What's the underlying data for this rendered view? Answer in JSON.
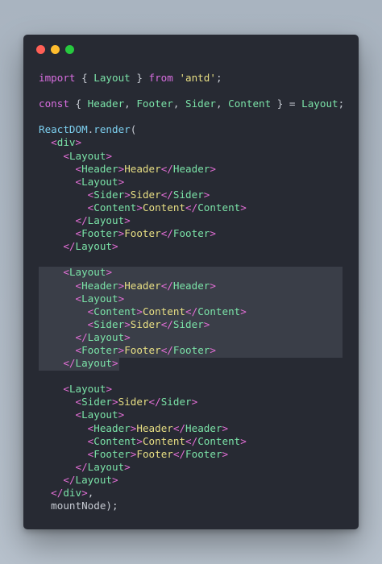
{
  "window": {
    "controls": [
      "close",
      "minimize",
      "maximize"
    ],
    "colors": {
      "close": "#ff5f56",
      "minimize": "#ffbd2e",
      "maximize": "#27c93f",
      "background": "#272a33"
    }
  },
  "code": {
    "language": "jsx",
    "highlighted_lines": [
      15,
      16,
      17,
      18,
      19,
      20,
      21
    ],
    "lines": [
      [
        {
          "t": "kw",
          "v": "import"
        },
        {
          "t": "pn",
          "v": " { "
        },
        {
          "t": "id",
          "v": "Layout"
        },
        {
          "t": "pn",
          "v": " } "
        },
        {
          "t": "kw",
          "v": "from"
        },
        {
          "t": "pn",
          "v": " "
        },
        {
          "t": "str",
          "v": "'antd'"
        },
        {
          "t": "pn",
          "v": ";"
        }
      ],
      [],
      [
        {
          "t": "kw",
          "v": "const"
        },
        {
          "t": "pn",
          "v": " { "
        },
        {
          "t": "id",
          "v": "Header"
        },
        {
          "t": "pn",
          "v": ", "
        },
        {
          "t": "id",
          "v": "Footer"
        },
        {
          "t": "pn",
          "v": ", "
        },
        {
          "t": "id",
          "v": "Sider"
        },
        {
          "t": "pn",
          "v": ", "
        },
        {
          "t": "id",
          "v": "Content"
        },
        {
          "t": "pn",
          "v": " } = "
        },
        {
          "t": "id",
          "v": "Layout"
        },
        {
          "t": "pn",
          "v": ";"
        }
      ],
      [],
      [
        {
          "t": "fn",
          "v": "ReactDOM"
        },
        {
          "t": "pn",
          "v": "."
        },
        {
          "t": "fn",
          "v": "render"
        },
        {
          "t": "pn",
          "v": "("
        }
      ],
      [
        {
          "t": "pn",
          "v": "  "
        },
        {
          "t": "tg",
          "v": "<"
        },
        {
          "t": "tn",
          "v": "div"
        },
        {
          "t": "tg",
          "v": ">"
        }
      ],
      [
        {
          "t": "pn",
          "v": "    "
        },
        {
          "t": "tg",
          "v": "<"
        },
        {
          "t": "tn",
          "v": "Layout"
        },
        {
          "t": "tg",
          "v": ">"
        }
      ],
      [
        {
          "t": "pn",
          "v": "      "
        },
        {
          "t": "tg",
          "v": "<"
        },
        {
          "t": "tn",
          "v": "Header"
        },
        {
          "t": "tg",
          "v": ">"
        },
        {
          "t": "tx",
          "v": "Header"
        },
        {
          "t": "tg",
          "v": "</"
        },
        {
          "t": "tn",
          "v": "Header"
        },
        {
          "t": "tg",
          "v": ">"
        }
      ],
      [
        {
          "t": "pn",
          "v": "      "
        },
        {
          "t": "tg",
          "v": "<"
        },
        {
          "t": "tn",
          "v": "Layout"
        },
        {
          "t": "tg",
          "v": ">"
        }
      ],
      [
        {
          "t": "pn",
          "v": "        "
        },
        {
          "t": "tg",
          "v": "<"
        },
        {
          "t": "tn",
          "v": "Sider"
        },
        {
          "t": "tg",
          "v": ">"
        },
        {
          "t": "tx",
          "v": "Sider"
        },
        {
          "t": "tg",
          "v": "</"
        },
        {
          "t": "tn",
          "v": "Sider"
        },
        {
          "t": "tg",
          "v": ">"
        }
      ],
      [
        {
          "t": "pn",
          "v": "        "
        },
        {
          "t": "tg",
          "v": "<"
        },
        {
          "t": "tn",
          "v": "Content"
        },
        {
          "t": "tg",
          "v": ">"
        },
        {
          "t": "tx",
          "v": "Content"
        },
        {
          "t": "tg",
          "v": "</"
        },
        {
          "t": "tn",
          "v": "Content"
        },
        {
          "t": "tg",
          "v": ">"
        }
      ],
      [
        {
          "t": "pn",
          "v": "      "
        },
        {
          "t": "tg",
          "v": "</"
        },
        {
          "t": "tn",
          "v": "Layout"
        },
        {
          "t": "tg",
          "v": ">"
        }
      ],
      [
        {
          "t": "pn",
          "v": "      "
        },
        {
          "t": "tg",
          "v": "<"
        },
        {
          "t": "tn",
          "v": "Footer"
        },
        {
          "t": "tg",
          "v": ">"
        },
        {
          "t": "tx",
          "v": "Footer"
        },
        {
          "t": "tg",
          "v": "</"
        },
        {
          "t": "tn",
          "v": "Footer"
        },
        {
          "t": "tg",
          "v": ">"
        }
      ],
      [
        {
          "t": "pn",
          "v": "    "
        },
        {
          "t": "tg",
          "v": "</"
        },
        {
          "t": "tn",
          "v": "Layout"
        },
        {
          "t": "tg",
          "v": ">"
        }
      ],
      [],
      [
        {
          "t": "pn",
          "v": "    "
        },
        {
          "t": "tg",
          "v": "<"
        },
        {
          "t": "tn",
          "v": "Layout"
        },
        {
          "t": "tg",
          "v": ">"
        }
      ],
      [
        {
          "t": "pn",
          "v": "      "
        },
        {
          "t": "tg",
          "v": "<"
        },
        {
          "t": "tn",
          "v": "Header"
        },
        {
          "t": "tg",
          "v": ">"
        },
        {
          "t": "tx",
          "v": "Header"
        },
        {
          "t": "tg",
          "v": "</"
        },
        {
          "t": "tn",
          "v": "Header"
        },
        {
          "t": "tg",
          "v": ">"
        }
      ],
      [
        {
          "t": "pn",
          "v": "      "
        },
        {
          "t": "tg",
          "v": "<"
        },
        {
          "t": "tn",
          "v": "Layout"
        },
        {
          "t": "tg",
          "v": ">"
        }
      ],
      [
        {
          "t": "pn",
          "v": "        "
        },
        {
          "t": "tg",
          "v": "<"
        },
        {
          "t": "tn",
          "v": "Content"
        },
        {
          "t": "tg",
          "v": ">"
        },
        {
          "t": "tx",
          "v": "Content"
        },
        {
          "t": "tg",
          "v": "</"
        },
        {
          "t": "tn",
          "v": "Content"
        },
        {
          "t": "tg",
          "v": ">"
        }
      ],
      [
        {
          "t": "pn",
          "v": "        "
        },
        {
          "t": "tg",
          "v": "<"
        },
        {
          "t": "tn",
          "v": "Sider"
        },
        {
          "t": "tg",
          "v": ">"
        },
        {
          "t": "tx",
          "v": "Sider"
        },
        {
          "t": "tg",
          "v": "</"
        },
        {
          "t": "tn",
          "v": "Sider"
        },
        {
          "t": "tg",
          "v": ">"
        }
      ],
      [
        {
          "t": "pn",
          "v": "      "
        },
        {
          "t": "tg",
          "v": "</"
        },
        {
          "t": "tn",
          "v": "Layout"
        },
        {
          "t": "tg",
          "v": ">"
        }
      ],
      [
        {
          "t": "pn",
          "v": "      "
        },
        {
          "t": "tg",
          "v": "<"
        },
        {
          "t": "tn",
          "v": "Footer"
        },
        {
          "t": "tg",
          "v": ">"
        },
        {
          "t": "tx",
          "v": "Footer"
        },
        {
          "t": "tg",
          "v": "</"
        },
        {
          "t": "tn",
          "v": "Footer"
        },
        {
          "t": "tg",
          "v": ">"
        }
      ],
      [
        {
          "t": "pn",
          "v": "    "
        },
        {
          "t": "tg",
          "v": "</"
        },
        {
          "t": "tn",
          "v": "Layout"
        },
        {
          "t": "tg",
          "v": ">"
        }
      ],
      [],
      [
        {
          "t": "pn",
          "v": "    "
        },
        {
          "t": "tg",
          "v": "<"
        },
        {
          "t": "tn",
          "v": "Layout"
        },
        {
          "t": "tg",
          "v": ">"
        }
      ],
      [
        {
          "t": "pn",
          "v": "      "
        },
        {
          "t": "tg",
          "v": "<"
        },
        {
          "t": "tn",
          "v": "Sider"
        },
        {
          "t": "tg",
          "v": ">"
        },
        {
          "t": "tx",
          "v": "Sider"
        },
        {
          "t": "tg",
          "v": "</"
        },
        {
          "t": "tn",
          "v": "Sider"
        },
        {
          "t": "tg",
          "v": ">"
        }
      ],
      [
        {
          "t": "pn",
          "v": "      "
        },
        {
          "t": "tg",
          "v": "<"
        },
        {
          "t": "tn",
          "v": "Layout"
        },
        {
          "t": "tg",
          "v": ">"
        }
      ],
      [
        {
          "t": "pn",
          "v": "        "
        },
        {
          "t": "tg",
          "v": "<"
        },
        {
          "t": "tn",
          "v": "Header"
        },
        {
          "t": "tg",
          "v": ">"
        },
        {
          "t": "tx",
          "v": "Header"
        },
        {
          "t": "tg",
          "v": "</"
        },
        {
          "t": "tn",
          "v": "Header"
        },
        {
          "t": "tg",
          "v": ">"
        }
      ],
      [
        {
          "t": "pn",
          "v": "        "
        },
        {
          "t": "tg",
          "v": "<"
        },
        {
          "t": "tn",
          "v": "Content"
        },
        {
          "t": "tg",
          "v": ">"
        },
        {
          "t": "tx",
          "v": "Content"
        },
        {
          "t": "tg",
          "v": "</"
        },
        {
          "t": "tn",
          "v": "Content"
        },
        {
          "t": "tg",
          "v": ">"
        }
      ],
      [
        {
          "t": "pn",
          "v": "        "
        },
        {
          "t": "tg",
          "v": "<"
        },
        {
          "t": "tn",
          "v": "Footer"
        },
        {
          "t": "tg",
          "v": ">"
        },
        {
          "t": "tx",
          "v": "Footer"
        },
        {
          "t": "tg",
          "v": "</"
        },
        {
          "t": "tn",
          "v": "Footer"
        },
        {
          "t": "tg",
          "v": ">"
        }
      ],
      [
        {
          "t": "pn",
          "v": "      "
        },
        {
          "t": "tg",
          "v": "</"
        },
        {
          "t": "tn",
          "v": "Layout"
        },
        {
          "t": "tg",
          "v": ">"
        }
      ],
      [
        {
          "t": "pn",
          "v": "    "
        },
        {
          "t": "tg",
          "v": "</"
        },
        {
          "t": "tn",
          "v": "Layout"
        },
        {
          "t": "tg",
          "v": ">"
        }
      ],
      [
        {
          "t": "pn",
          "v": "  "
        },
        {
          "t": "tg",
          "v": "</"
        },
        {
          "t": "tn",
          "v": "div"
        },
        {
          "t": "tg",
          "v": ">"
        },
        {
          "t": "pn",
          "v": ","
        }
      ],
      [
        {
          "t": "pn",
          "v": "  mountNode);"
        }
      ]
    ]
  }
}
